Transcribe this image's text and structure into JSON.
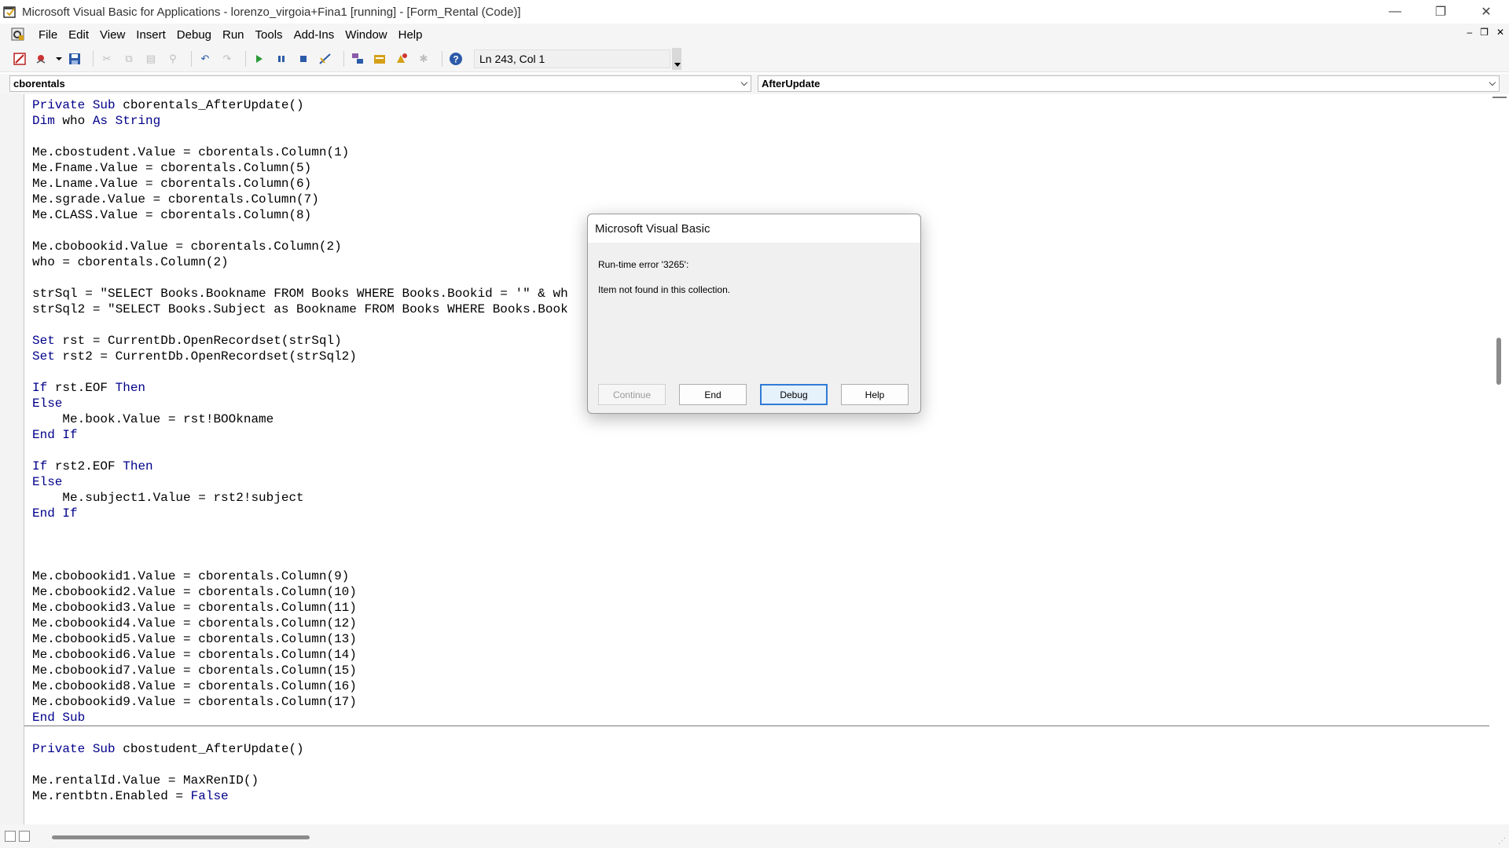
{
  "window": {
    "title": "Microsoft Visual Basic for Applications - lorenzo_virgoia+Fina1 [running] - [Form_Rental (Code)]",
    "controls": [
      "—",
      "❐",
      "✕"
    ]
  },
  "menu": {
    "items": [
      "File",
      "Edit",
      "View",
      "Insert",
      "Debug",
      "Run",
      "Tools",
      "Add-Ins",
      "Window",
      "Help"
    ],
    "mdi_controls": [
      "–",
      "❐",
      "✕"
    ]
  },
  "toolbar": {
    "position": "Ln 243, Col 1",
    "icons": [
      "view-access-icon",
      "insert-userform-icon",
      "dropdown-icon",
      "save-icon",
      "cut-icon",
      "copy-icon",
      "paste-icon",
      "find-icon",
      "undo-icon",
      "redo-icon",
      "run-icon",
      "break-icon",
      "reset-icon",
      "design-mode-icon",
      "project-explorer-icon",
      "properties-icon",
      "object-browser-icon",
      "toolbox-icon",
      "help-icon"
    ]
  },
  "combos": {
    "object": "cborentals",
    "procedure": "AfterUpdate"
  },
  "code_lines": [
    [
      [
        "k",
        "Private Sub "
      ],
      [
        "t",
        "cborentals_AfterUpdate()"
      ]
    ],
    [
      [
        "k",
        "Dim "
      ],
      [
        "t",
        "who "
      ],
      [
        "k",
        "As String"
      ]
    ],
    [],
    [
      [
        "t",
        "Me.cbostudent.Value = cborentals.Column(1)"
      ]
    ],
    [
      [
        "t",
        "Me.Fname.Value = cborentals.Column(5)"
      ]
    ],
    [
      [
        "t",
        "Me.Lname.Value = cborentals.Column(6)"
      ]
    ],
    [
      [
        "t",
        "Me.sgrade.Value = cborentals.Column(7)"
      ]
    ],
    [
      [
        "t",
        "Me.CLASS.Value = cborentals.Column(8)"
      ]
    ],
    [],
    [
      [
        "t",
        "Me.cbobookid.Value = cborentals.Column(2)"
      ]
    ],
    [
      [
        "t",
        "who = cborentals.Column(2)"
      ]
    ],
    [],
    [
      [
        "t",
        "strSql = \"SELECT Books.Bookname FROM Books WHERE Books.Bookid = '\" & wh"
      ]
    ],
    [
      [
        "t",
        "strSql2 = \"SELECT Books.Subject as Bookname FROM Books WHERE Books.Book"
      ]
    ],
    [],
    [
      [
        "k",
        "Set "
      ],
      [
        "t",
        "rst = CurrentDb.OpenRecordset(strSql)"
      ]
    ],
    [
      [
        "k",
        "Set "
      ],
      [
        "t",
        "rst2 = CurrentDb.OpenRecordset(strSql2)"
      ]
    ],
    [],
    [
      [
        "k",
        "If "
      ],
      [
        "t",
        "rst.EOF "
      ],
      [
        "k",
        "Then"
      ]
    ],
    [
      [
        "k",
        "Else"
      ]
    ],
    [
      [
        "t",
        "    Me.book.Value = rst!BOOkname"
      ]
    ],
    [
      [
        "k",
        "End If"
      ]
    ],
    [],
    [
      [
        "k",
        "If "
      ],
      [
        "t",
        "rst2.EOF "
      ],
      [
        "k",
        "Then"
      ]
    ],
    [
      [
        "k",
        "Else"
      ]
    ],
    [
      [
        "t",
        "    Me.subject1.Value = rst2!subject"
      ]
    ],
    [
      [
        "k",
        "End If"
      ]
    ],
    [],
    [],
    [],
    [
      [
        "t",
        "Me.cbobookid1.Value = cborentals.Column(9)"
      ]
    ],
    [
      [
        "t",
        "Me.cbobookid2.Value = cborentals.Column(10)"
      ]
    ],
    [
      [
        "t",
        "Me.cbobookid3.Value = cborentals.Column(11)"
      ]
    ],
    [
      [
        "t",
        "Me.cbobookid4.Value = cborentals.Column(12)"
      ]
    ],
    [
      [
        "t",
        "Me.cbobookid5.Value = cborentals.Column(13)"
      ]
    ],
    [
      [
        "t",
        "Me.cbobookid6.Value = cborentals.Column(14)"
      ]
    ],
    [
      [
        "t",
        "Me.cbobookid7.Value = cborentals.Column(15)"
      ]
    ],
    [
      [
        "t",
        "Me.cbobookid8.Value = cborentals.Column(16)"
      ]
    ],
    [
      [
        "t",
        "Me.cbobookid9.Value = cborentals.Column(17)"
      ]
    ],
    [
      [
        "k",
        "End Sub"
      ]
    ],
    [],
    [
      [
        "k",
        "Private Sub "
      ],
      [
        "t",
        "cbostudent_AfterUpdate()"
      ]
    ],
    [],
    [
      [
        "t",
        "Me.rentalId.Value = MaxRenID()"
      ]
    ],
    [
      [
        "t",
        "Me.rentbtn.Enabled = "
      ],
      [
        "k",
        "False"
      ]
    ]
  ],
  "dialog": {
    "title": "Microsoft Visual Basic",
    "error_line": "Run-time error '3265':",
    "message": "Item not found in this collection.",
    "buttons": {
      "continue": "Continue",
      "end": "End",
      "debug": "Debug",
      "help": "Help"
    }
  }
}
